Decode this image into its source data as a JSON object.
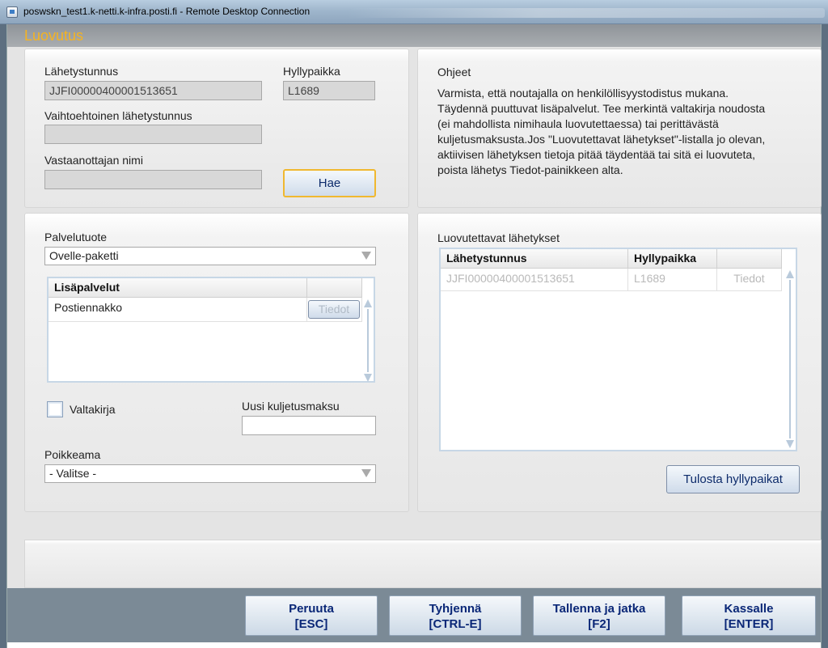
{
  "window": {
    "title": "poswskn_test1.k-netti.k-infra.posti.fi - Remote Desktop Connection"
  },
  "app": {
    "title": "Luovutus"
  },
  "search_panel": {
    "tracking_label": "Lähetystunnus",
    "tracking_value": "JJFI00000400001513651",
    "shelf_label": "Hyllypaikka",
    "shelf_value": "L1689",
    "alt_tracking_label": "Vaihtoehtoinen lähetystunnus",
    "alt_tracking_value": "",
    "recipient_label": "Vastaanottajan nimi",
    "recipient_value": "",
    "search_button": "Hae"
  },
  "instructions": {
    "title": "Ohjeet",
    "lines": [
      "Varmista, että noutajalla on henkilöllisyystodistus mukana.",
      "Täydennä puuttuvat lisäpalvelut. Tee merkintä valtakirja noudosta",
      "(ei mahdollista nimihaula luovutettaessa) tai perittävästä",
      "kuljetusmaksusta.Jos \"Luovutettavat lähetykset\"-listalla jo olevan,",
      "aktiivisen lähetyksen tietoja pitää täydentää tai sitä ei luovuteta,",
      "poista lähetys Tiedot-painikkeen alta."
    ]
  },
  "service_panel": {
    "product_label": "Palvelutuote",
    "product_value": "Ovelle-paketti",
    "extras_header": "Lisäpalvelut",
    "extras": [
      {
        "name": "Postiennakko",
        "button": "Tiedot"
      }
    ],
    "proxy_label": "Valtakirja",
    "new_fee_label": "Uusi kuljetusmaksu",
    "new_fee_value": "",
    "deviation_label": "Poikkeama",
    "deviation_value": "- Valitse -"
  },
  "handover_panel": {
    "title": "Luovutettavat lähetykset",
    "columns": [
      "Lähetystunnus",
      "Hyllypaikka"
    ],
    "rows": [
      {
        "tracking": "JJFI00000400001513651",
        "shelf": "L1689",
        "button": "Tiedot"
      }
    ],
    "print_button": "Tulosta hyllypaikat"
  },
  "footer": {
    "buttons": [
      {
        "line1": "Peruuta",
        "line2": "[ESC]"
      },
      {
        "line1": "Tyhjennä",
        "line2": "[CTRL-E]"
      },
      {
        "line1": "Tallenna ja jatka",
        "line2": "[F2]"
      },
      {
        "line1": "Kassalle",
        "line2": "[ENTER]"
      }
    ]
  },
  "colors": {
    "accent_title": "#f5b321",
    "button_text": "#0a2777",
    "highlight_border": "#f0b830"
  }
}
